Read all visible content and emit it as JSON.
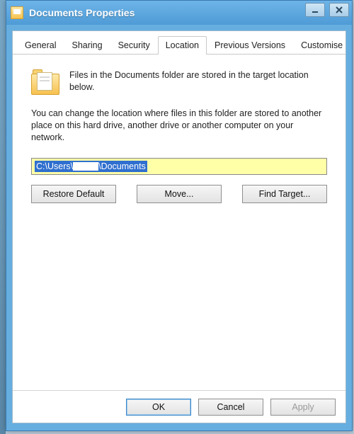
{
  "window": {
    "title": "Documents Properties"
  },
  "tabs": {
    "items": [
      {
        "label": "General"
      },
      {
        "label": "Sharing"
      },
      {
        "label": "Security"
      },
      {
        "label": "Location"
      },
      {
        "label": "Previous Versions"
      },
      {
        "label": "Customise"
      }
    ],
    "activeIndex": 3
  },
  "location": {
    "intro": "Files in the Documents folder are stored in the target location below.",
    "description": "You can change the location where files in this folder are stored to another place on this hard drive, another drive or another computer on your network.",
    "path_prefix": "C:\\Users\\",
    "path_suffix": "\\Documents",
    "buttons": {
      "restore": "Restore Default",
      "move": "Move...",
      "find": "Find Target..."
    }
  },
  "footer": {
    "ok": "OK",
    "cancel": "Cancel",
    "apply": "Apply"
  }
}
